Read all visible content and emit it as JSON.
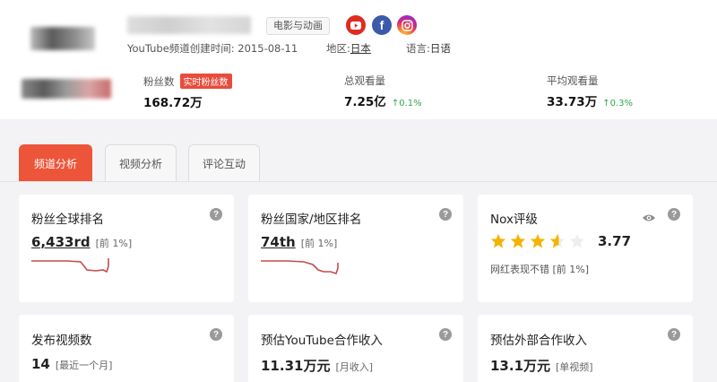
{
  "header": {
    "category": "电影与动画",
    "meta": {
      "create_label": "YouTube频道创建时间:",
      "create_date": "2015-08-11",
      "region_label": "地区:",
      "region_value": "日本",
      "language_label": "语言:",
      "language_value": "日语"
    },
    "social_icons": [
      "youtube-icon",
      "facebook-icon",
      "instagram-icon"
    ],
    "facebook_glyph": "f",
    "stats": [
      {
        "label": "粉丝数",
        "badge": "实时粉丝数",
        "value": "168.72万",
        "change": ""
      },
      {
        "label": "总观看量",
        "value": "7.25亿",
        "change": "0.1%"
      },
      {
        "label": "平均观看量",
        "value": "33.73万",
        "change": "0.3%"
      }
    ]
  },
  "tabs": [
    "频道分析",
    "视频分析",
    "评论互动"
  ],
  "active_tab": 0,
  "cards": {
    "global_rank": {
      "title": "粉丝全球排名",
      "value": "6,433rd",
      "note": "[前 1%]"
    },
    "country_rank": {
      "title": "粉丝国家/地区排名",
      "value": "74th",
      "note": "[前 1%]"
    },
    "nox": {
      "title": "Nox评级",
      "rating": "3.77",
      "rating_value": 3.77,
      "sub": "网红表现不错 [前 1%]"
    },
    "videos": {
      "title": "发布视频数",
      "value": "14",
      "note": "[最近一个月]"
    },
    "yt_income": {
      "title": "预估YouTube合作收入",
      "value": "11.31万元",
      "note": "[月收入]"
    },
    "ext_income": {
      "title": "预估外部合作收入",
      "value": "13.1万元",
      "note": "[单视频]"
    }
  },
  "help_glyph": "?",
  "arrow_glyph": "↑",
  "colors": {
    "accent": "#ed553a",
    "up": "#2ea84a",
    "star": "#f5b301",
    "youtube": "#e02b20",
    "facebook": "#3b5aa9"
  }
}
